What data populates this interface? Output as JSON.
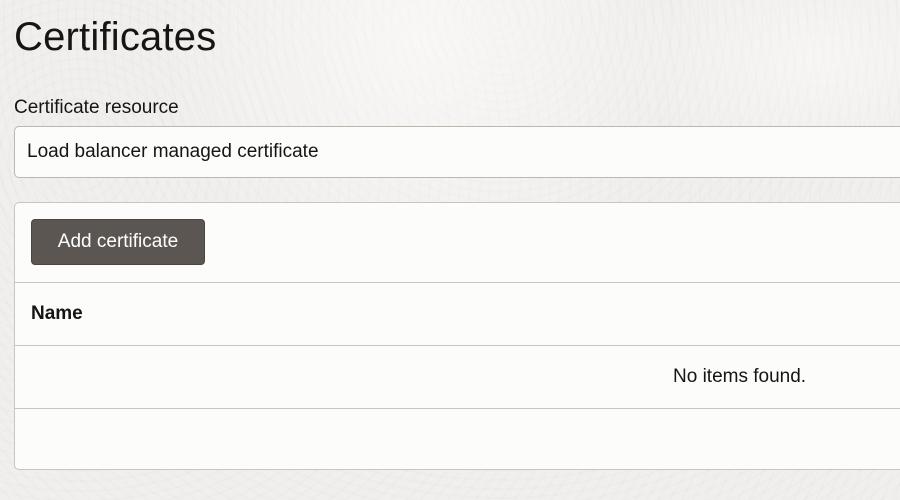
{
  "page": {
    "title": "Certificates"
  },
  "certificate_resource": {
    "label": "Certificate resource",
    "value": "Load balancer managed certificate"
  },
  "table": {
    "add_button_label": "Add certificate",
    "columns": [
      "Name"
    ],
    "rows": [],
    "empty_message": "No items found."
  },
  "colors": {
    "background": "#f1efed",
    "button": "#5b5652",
    "border": "#c9c4c0"
  }
}
